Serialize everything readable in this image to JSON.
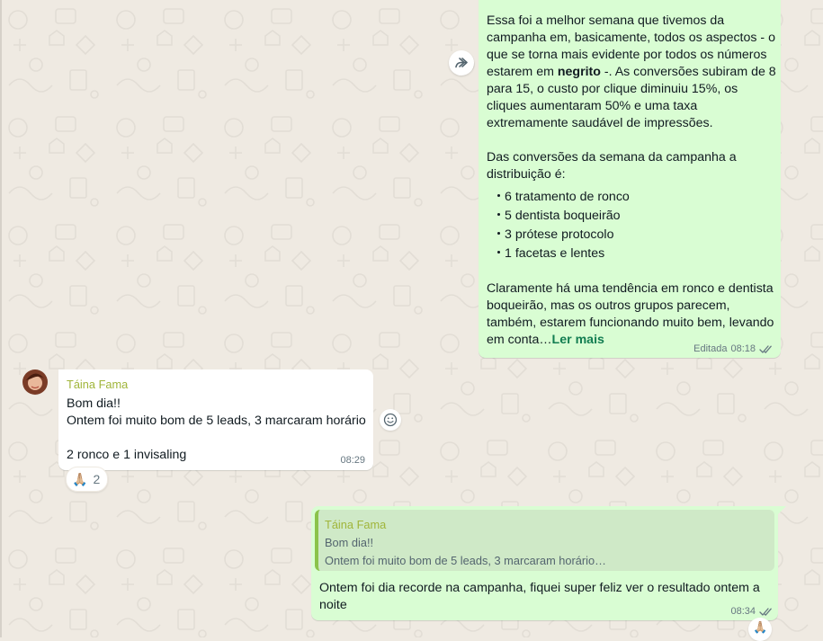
{
  "colors": {
    "outgoing_bubble": "#d9fdd3",
    "incoming_bubble": "#ffffff",
    "chat_background": "#efeae2",
    "read_ticks": "#667781",
    "sender_name": "#a0b53a",
    "read_more_link": "#127d51"
  },
  "message1": {
    "para1_a": "Essa foi a melhor semana que tivemos da campanha em, basicamente, todos os aspectos - o que se torna mais evidente por todos os números estarem em ",
    "para1_bold": "negrito",
    "para1_b": " -. As conversões subiram de 8 para 15, o custo por clique diminuiu 15%, os cliques aumentaram 50% e uma taxa extremamente saudável de impressões.",
    "para2": "Das conversões da semana da campanha a distribuição é:",
    "bullets": [
      "6 tratamento de ronco",
      "5 dentista boqueirão",
      "3 prótese protocolo",
      "1 facetas e lentes"
    ],
    "para3": "Claramente há uma tendência em ronco e dentista boqueirão, mas os outros grupos parecem, também, estarem funcionando muito bem, levando em conta…",
    "read_more": "Ler mais",
    "edited_label": "Editada",
    "time": "08:18",
    "forward_icon": "forward-icon",
    "status_icon": "double-check-icon"
  },
  "message2": {
    "sender": "Táina Fama",
    "line1": "Bom dia!!",
    "line2": "Ontem foi muito bom de 5 leads, 3 marcaram horário",
    "line3": "2 ronco e 1 invisaling",
    "time": "08:29",
    "reaction_emoji": "🙏🏼",
    "reaction_count": "2",
    "emoji_button_icon": "smiley-icon"
  },
  "message3": {
    "quoted_sender": "Táina Fama",
    "quoted_line1": "Bom dia!!",
    "quoted_line2": "Ontem foi muito bom de 5 leads, 3 marcaram horário…",
    "text": "Ontem foi dia recorde na campanha, fiquei super feliz ver o resultado ontem a noite",
    "time": "08:34",
    "reaction_emoji": "🙏🏼",
    "status_icon": "double-check-icon"
  }
}
